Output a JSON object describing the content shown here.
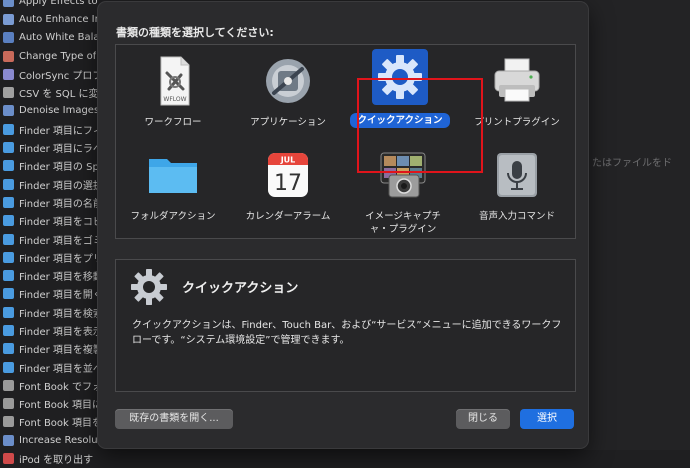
{
  "background_list": [
    {
      "label": "Apply Effects to Images",
      "color": "#6b8ec9"
    },
    {
      "label": "Auto Enhance Im",
      "color": "#7a9bd3"
    },
    {
      "label": "Auto White Balan",
      "color": "#5a7fc0"
    },
    {
      "label": "Change Type of",
      "color": "#c96a5a"
    },
    {
      "label": "ColorSync プロフ",
      "color": "#8a8ad0"
    },
    {
      "label": "CSV を SQL に変換",
      "color": "#a0a0a0"
    },
    {
      "label": "Denoise Images",
      "color": "#6b8ec9"
    },
    {
      "label": "Finder 項目にフィ",
      "color": "#4a9be0"
    },
    {
      "label": "Finder 項目にラベ",
      "color": "#4a9be0"
    },
    {
      "label": "Finder 項目の Spo",
      "color": "#4a9be0"
    },
    {
      "label": "Finder 項目の選択",
      "color": "#4a9be0"
    },
    {
      "label": "Finder 項目の名前",
      "color": "#4a9be0"
    },
    {
      "label": "Finder 項目をコピ",
      "color": "#4a9be0"
    },
    {
      "label": "Finder 項目をゴミ",
      "color": "#4a9be0"
    },
    {
      "label": "Finder 項目をプリ",
      "color": "#4a9be0"
    },
    {
      "label": "Finder 項目を移動",
      "color": "#4a9be0"
    },
    {
      "label": "Finder 項目を開く",
      "color": "#4a9be0"
    },
    {
      "label": "Finder 項目を検索",
      "color": "#4a9be0"
    },
    {
      "label": "Finder 項目を表示",
      "color": "#4a9be0"
    },
    {
      "label": "Finder 項目を複製",
      "color": "#4a9be0"
    },
    {
      "label": "Finder 項目を並べ",
      "color": "#4a9be0"
    },
    {
      "label": "Font Book でフォ",
      "color": "#9a9a9a"
    },
    {
      "label": "Font Book 項目に",
      "color": "#9a9a9a"
    },
    {
      "label": "Font Book 項目を",
      "color": "#9a9a9a"
    },
    {
      "label": "Increase Resolut",
      "color": "#6b8ec9"
    },
    {
      "label": "iPod を取り出す",
      "color": "#d04a4a"
    }
  ],
  "right_hint": "たはファイルをド",
  "dialog": {
    "title": "書類の種類を選択してください:",
    "types": [
      {
        "label": "ワークフロー",
        "icon": "workflow-document-icon",
        "selected": false
      },
      {
        "label": "アプリケーション",
        "icon": "application-robot-icon",
        "selected": false
      },
      {
        "label": "クイックアクション",
        "icon": "gear-icon",
        "selected": true
      },
      {
        "label": "プリントプラグイン",
        "icon": "printer-icon",
        "selected": false
      },
      {
        "label": "フォルダアクション",
        "icon": "folder-icon",
        "selected": false
      },
      {
        "label": "カレンダーアラーム",
        "icon": "calendar-icon",
        "selected": false
      },
      {
        "label": "イメージキャプチ\nャ・プラグイン",
        "icon": "image-capture-icon",
        "selected": false
      },
      {
        "label": "音声入力コマンド",
        "icon": "microphone-icon",
        "selected": false
      }
    ],
    "calendar_month": "JUL",
    "calendar_day": "17",
    "workflow_caption": "WFLOW",
    "description": {
      "title": "クイックアクション",
      "body": "クイックアクションは、Finder、Touch Bar、および“サービス”メニューに追加できるワークフローです。“システム環境設定”で管理できます。"
    },
    "buttons": {
      "open_existing": "既存の書類を開く...",
      "close": "閉じる",
      "choose": "選択"
    }
  }
}
